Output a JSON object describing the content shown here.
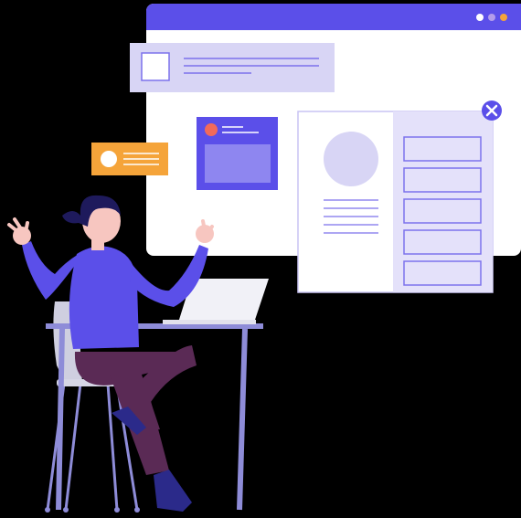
{
  "illustration": {
    "background": "#000000",
    "palette": {
      "primary": "#5B4FE9",
      "primary_light": "#D8D5F5",
      "panel_bg": "#E4E1FA",
      "white": "#FFFFFF",
      "orange": "#F5A43A",
      "coral": "#F26A5A",
      "skin": "#F7C6C0",
      "hair": "#1E1A5C",
      "pants": "#5A2A55",
      "shoe": "#2B2A8A",
      "table_leg": "#8E8CD8",
      "laptop": "#F1F1F7"
    },
    "browser_window": {
      "dots": [
        "#FFFFFF",
        "#B39DEB",
        "#F5A43A"
      ]
    },
    "icons": [
      "close-icon",
      "avatar-placeholder-icon",
      "image-placeholder-icon"
    ]
  }
}
